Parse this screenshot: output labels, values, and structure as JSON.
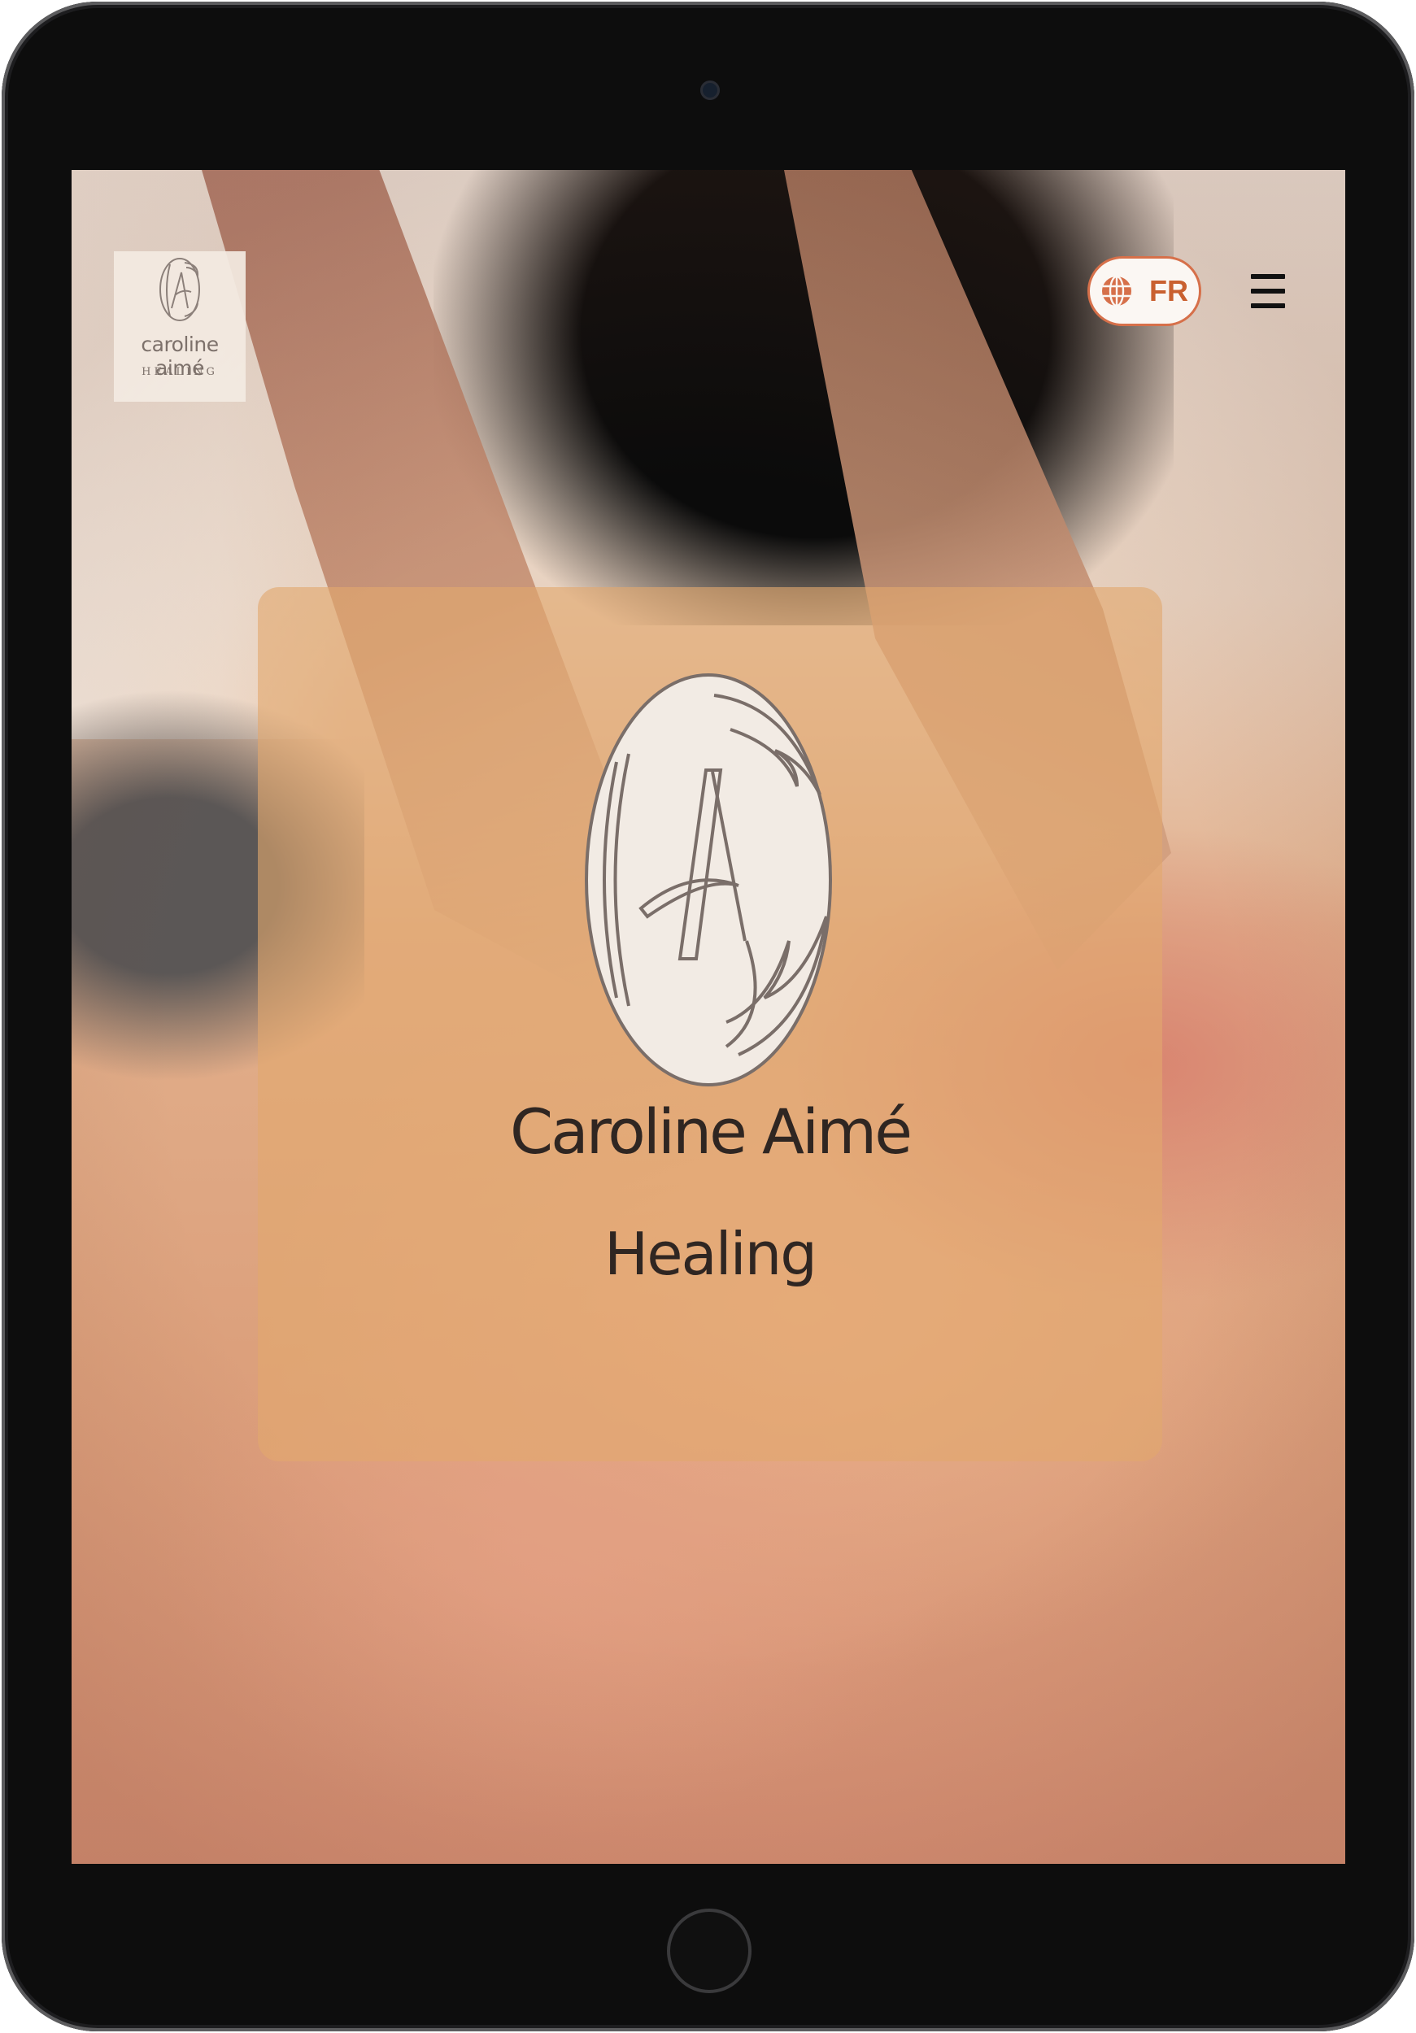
{
  "header": {
    "logo": {
      "name": "caroline aimé",
      "tagline": "HEALING"
    },
    "language": {
      "current": "FR",
      "icon": "globe-icon"
    },
    "menu": {
      "icon": "hamburger-menu-icon"
    }
  },
  "hero": {
    "emblem_icon": "ca-monogram-emblem",
    "title": "Caroline Aimé",
    "subtitle": "Healing"
  },
  "colors": {
    "accent": "#d6704a",
    "accent_text": "#c9602f",
    "card_overlay": "#e2a86e",
    "text_dark": "#2f2622",
    "logo_text": "#7d716b",
    "emblem_fill": "#f2ebe4",
    "emblem_stroke": "#7a6e69"
  }
}
